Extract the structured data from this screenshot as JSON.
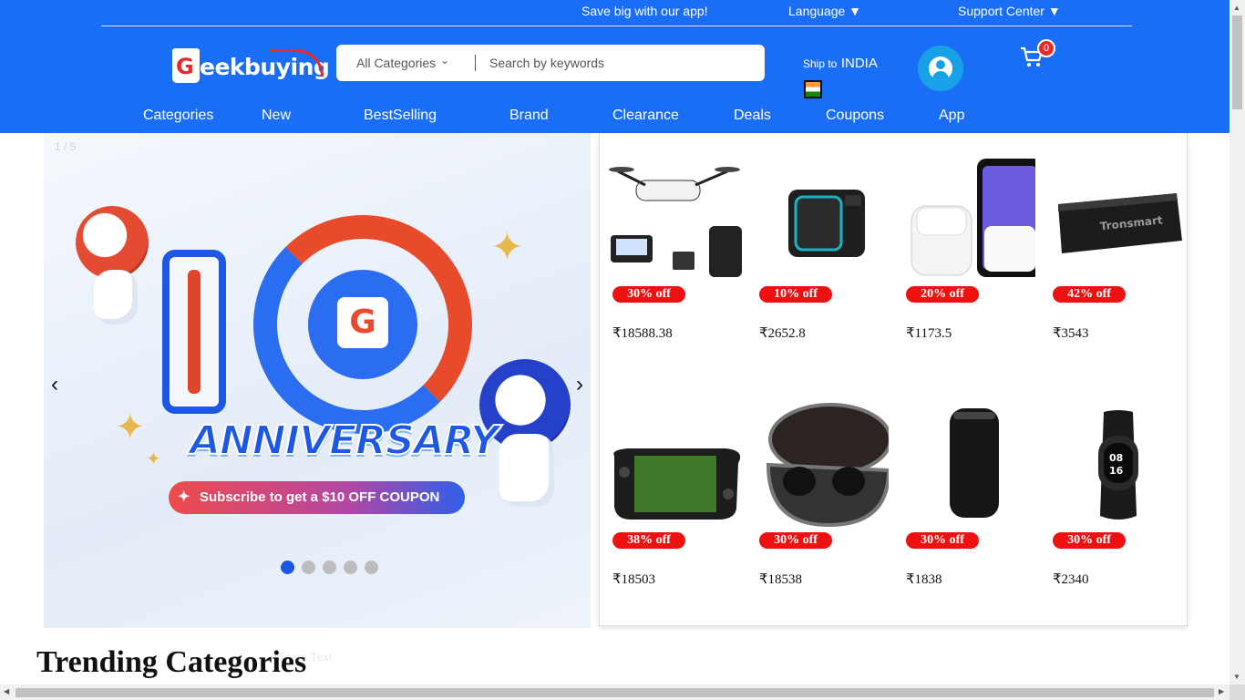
{
  "topbar": {
    "app_promo": "Save big with our app!",
    "language": "Language ▼",
    "support": "Support Center ▼"
  },
  "logo": {
    "initial": "G",
    "text": "eekbuying"
  },
  "search": {
    "category": "All Categories",
    "placeholder": "Search by keywords"
  },
  "ship": {
    "label": "Ship to",
    "country": "INDIA"
  },
  "cart": {
    "count": "0"
  },
  "nav": [
    "Categories",
    "New",
    "BestSelling",
    "Brand",
    "Clearance",
    "Deals",
    "Coupons",
    "App"
  ],
  "banner": {
    "counter": "1 / 5",
    "prev": "‹",
    "next": "›",
    "headline": "ANNIVERSARY",
    "cta": "Subscribe to get a $10 OFF COUPON",
    "slide_count": 5,
    "active_slide": 1
  },
  "products": [
    {
      "name": "drone",
      "discount": "30% off",
      "price": "₹18588.38"
    },
    {
      "name": "speaker-square",
      "discount": "10% off",
      "price": "₹2652.8"
    },
    {
      "name": "earbuds-phone",
      "discount": "20% off",
      "price": "₹1173.5"
    },
    {
      "name": "tronsmart-speaker",
      "discount": "42% off",
      "price": "₹3543"
    },
    {
      "name": "handheld-pc",
      "discount": "38% off",
      "price": "₹18503"
    },
    {
      "name": "tws-earbuds",
      "discount": "30% off",
      "price": "₹18538"
    },
    {
      "name": "cylinder-speaker",
      "discount": "30% off",
      "price": "₹1838"
    },
    {
      "name": "smart-band",
      "discount": "30% off",
      "price": "₹2340"
    }
  ],
  "section": {
    "trending": "Trending Categories",
    "muted_text": "Spam Text"
  },
  "colors": {
    "header_blue": "#1a6ef6",
    "discount_red": "#ee1111",
    "cart_badge": "#e52a2a"
  }
}
